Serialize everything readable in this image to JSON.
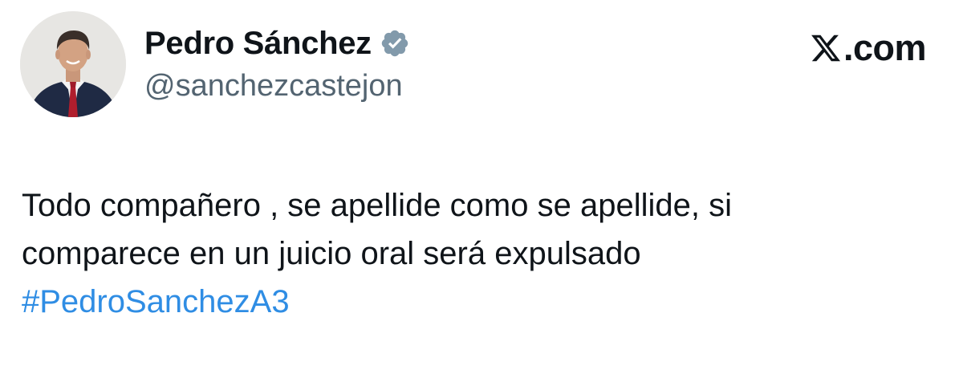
{
  "author": {
    "display_name": "Pedro Sánchez",
    "handle": "@sanchezcastejon",
    "verified": true,
    "verified_badge_color": "#829aab",
    "avatar_icon": "profile-photo"
  },
  "brand": {
    "logo_icon": "x-logo-icon",
    "text": ".com"
  },
  "tweet": {
    "lines": [
      "Todo compañero , se apellide como se apellide, si",
      "comparece en un juicio oral será expulsado"
    ],
    "hashtag": "#PedroSanchezA3"
  },
  "colors": {
    "text": "#0f1419",
    "handle": "#536471",
    "hashtag": "#2f8de4",
    "background": "#ffffff"
  }
}
